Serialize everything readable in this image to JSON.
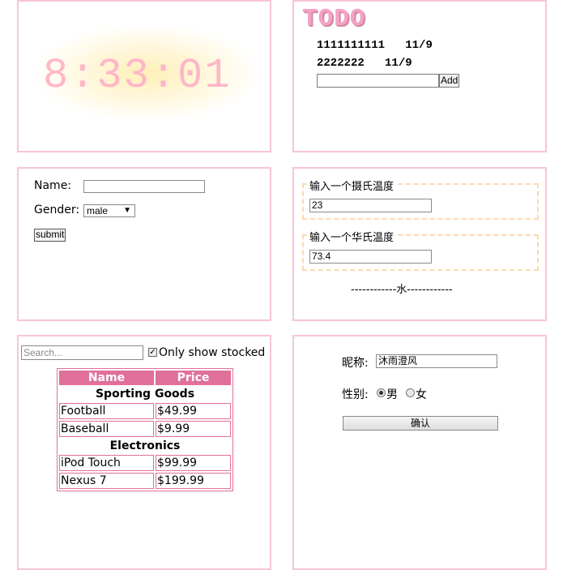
{
  "clock": {
    "time": "8:33:01"
  },
  "todo": {
    "title": "TODO",
    "items": [
      {
        "text": "1111111111",
        "date": "11/9"
      },
      {
        "text": "2222222",
        "date": "11/9"
      }
    ],
    "input_value": "",
    "add_label": "Add"
  },
  "form": {
    "name_label": "Name:",
    "name_value": "",
    "gender_label": "Gender:",
    "gender_selected": "male",
    "submit_label": "submit"
  },
  "temperature": {
    "celsius_legend": "输入一个摄氏温度",
    "celsius_value": "23",
    "fahrenheit_legend": "输入一个华氏温度",
    "fahrenheit_value": "73.4",
    "verdict": "------------水------------"
  },
  "products": {
    "search_placeholder": "Search...",
    "stocked_label": "Only show stocked",
    "stocked_checked": true,
    "headers": [
      "Name",
      "Price"
    ],
    "categories": [
      {
        "name": "Sporting Goods",
        "items": [
          [
            "Football",
            "$49.99"
          ],
          [
            "Baseball",
            "$9.99"
          ]
        ]
      },
      {
        "name": "Electronics",
        "items": [
          [
            "iPod Touch",
            "$99.99"
          ],
          [
            "Nexus 7",
            "$199.99"
          ]
        ]
      }
    ]
  },
  "profile": {
    "nickname_label": "昵称:",
    "nickname_value": "沐雨澄风",
    "gender_label": "性别:",
    "options": [
      "男",
      "女"
    ],
    "selected": "男",
    "confirm_label": "确认"
  },
  "colors": {
    "panel_border": "#f7c5d4",
    "table_accent": "#e0709a",
    "clock_text": "#ffb6c8",
    "fieldset_border": "#fbd9b0"
  }
}
